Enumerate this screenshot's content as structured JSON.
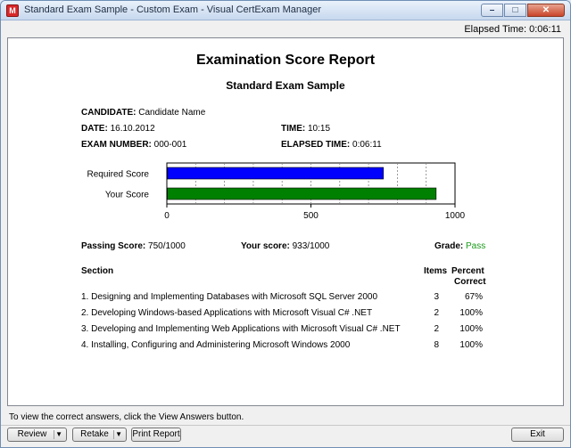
{
  "window": {
    "title": "Standard Exam Sample - Custom Exam - Visual CertExam Manager",
    "icon_letter": "M"
  },
  "elapsed_time_header": "Elapsed Time: 0:06:11",
  "report": {
    "title": "Examination Score Report",
    "subtitle": "Standard Exam Sample",
    "candidate_label": "CANDIDATE:",
    "candidate_value": "Candidate Name",
    "date_label": "DATE:",
    "date_value": "16.10.2012",
    "time_label": "TIME:",
    "time_value": "10:15",
    "exam_number_label": "EXAM NUMBER:",
    "exam_number_value": "000-001",
    "elapsed_label": "ELAPSED TIME:",
    "elapsed_value": "0:06:11",
    "passing_label": "Passing Score:",
    "passing_value": "750/1000",
    "your_score_label": "Your score:",
    "your_score_value": "933/1000",
    "grade_label": "Grade:",
    "grade_value": "Pass",
    "section_header": "Section",
    "items_header": "Items",
    "percent_header_1": "Percent",
    "percent_header_2": "Correct",
    "sections": [
      {
        "name": "1. Designing and Implementing Databases with Microsoft SQL Server 2000",
        "items": "3",
        "percent": "67%"
      },
      {
        "name": "2. Developing Windows-based Applications with Microsoft Visual C# .NET",
        "items": "2",
        "percent": "100%"
      },
      {
        "name": "3. Developing and Implementing Web Applications with Microsoft Visual C# .NET",
        "items": "2",
        "percent": "100%"
      },
      {
        "name": "4. Installing, Configuring and Administering Microsoft Windows 2000",
        "items": "8",
        "percent": "100%"
      }
    ]
  },
  "chart_data": {
    "type": "bar",
    "orientation": "horizontal",
    "categories": [
      "Required Score",
      "Your Score"
    ],
    "values": [
      750,
      933
    ],
    "colors": [
      "#0000ff",
      "#008000"
    ],
    "xlim": [
      0,
      1000
    ],
    "xticks": [
      "0",
      "500",
      "1000"
    ],
    "grid": true
  },
  "status_text": "To view the correct answers, click the View Answers button.",
  "buttons": {
    "review": "Review",
    "retake": "Retake",
    "print": "Print Report",
    "exit": "Exit"
  }
}
